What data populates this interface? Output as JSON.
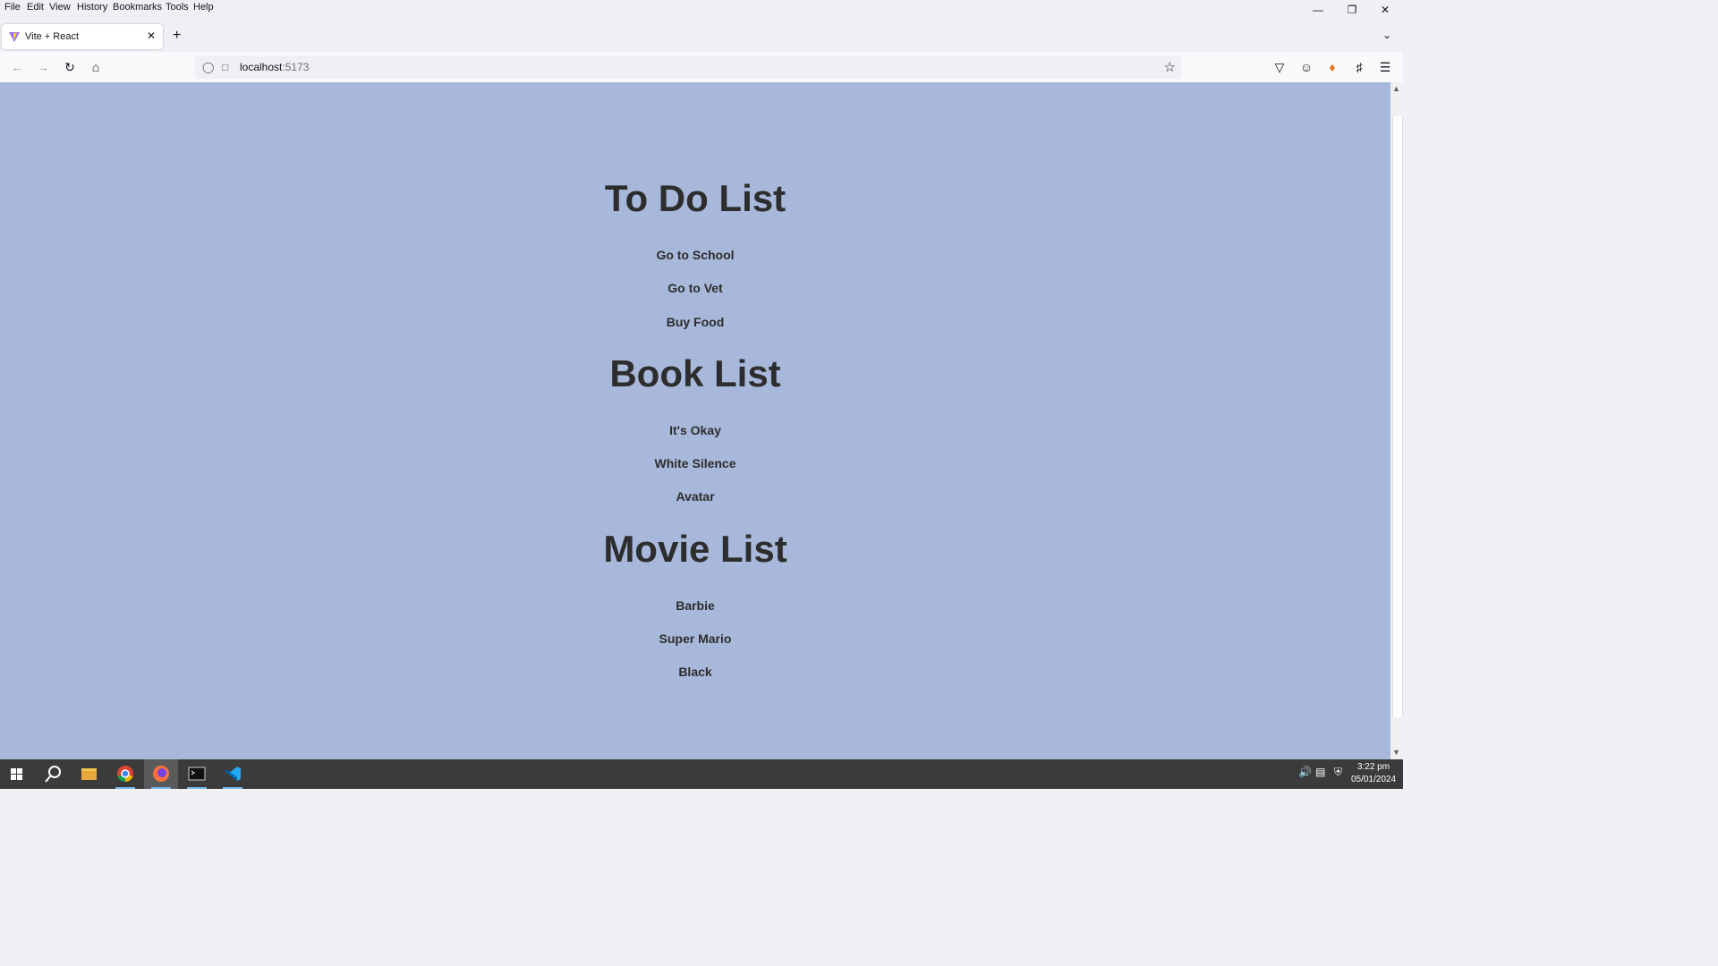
{
  "menu": [
    "File",
    "Edit",
    "View",
    "History",
    "Bookmarks",
    "Tools",
    "Help"
  ],
  "tab": {
    "title": "Vite + React"
  },
  "urlbar": {
    "host": "localhost",
    "port": ":5173"
  },
  "sections": [
    {
      "title": "To Do List",
      "items": [
        "Go to School",
        "Go to Vet",
        "Buy Food"
      ]
    },
    {
      "title": "Book List",
      "items": [
        "It's Okay",
        "White Silence",
        "Avatar"
      ]
    },
    {
      "title": "Movie List",
      "items": [
        "Barbie",
        "Super Mario",
        "Black"
      ]
    }
  ],
  "taskbar": {
    "time": "3:22 pm",
    "date": "05/01/2024"
  },
  "colors": {
    "page_background": "#a8b8db",
    "text": "#2d2d2d",
    "taskbar": "#3b3b3b"
  }
}
